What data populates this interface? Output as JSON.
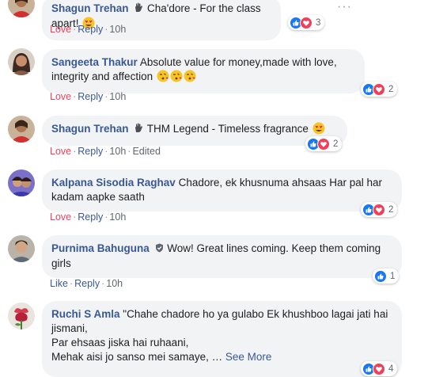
{
  "colors": {
    "link_blue": "#385898",
    "love_red": "#f33e58",
    "bubble_bg": "#f2f3f5",
    "meta_gray": "#606770"
  },
  "comments": [
    {
      "author": "Shagun Trehan",
      "author_badge_icon": "waving-hand-icon",
      "text": "Cha'dore - For the class apart!",
      "emojis": [
        "heart-eyes-emoji-icon"
      ],
      "reaction_label": "Love",
      "reply_label": "Reply",
      "time": "10h",
      "edited": "",
      "reaction_count": "3",
      "reaction_icons": [
        "like-reaction-icon",
        "love-reaction-icon"
      ]
    },
    {
      "author": "Sangeeta Thakur",
      "text": "Absolute value for money,made with love, integrity and affection",
      "emojis": [
        "kissing-heart-emoji-icon",
        "kissing-heart-emoji-icon",
        "kissing-heart-emoji-icon"
      ],
      "reaction_label": "Love",
      "reply_label": "Reply",
      "time": "10h",
      "reaction_count": "2",
      "reaction_icons": [
        "like-reaction-icon",
        "love-reaction-icon"
      ]
    },
    {
      "author": "Shagun Trehan",
      "author_badge_icon": "waving-hand-icon",
      "text": "THM Legend - Timeless fragrance",
      "emojis": [
        "heart-eyes-emoji-icon"
      ],
      "reaction_label": "Love",
      "reply_label": "Reply",
      "time": "10h",
      "edited": "Edited",
      "reaction_count": "2",
      "reaction_icons": [
        "like-reaction-icon",
        "love-reaction-icon"
      ]
    },
    {
      "author": "Kalpana Sisodia Raghav",
      "text": "Chadore, ek khusnuma ahsaas Har pal har kadam aapke saath",
      "reaction_label": "Love",
      "reply_label": "Reply",
      "time": "10h",
      "reaction_count": "2",
      "reaction_icons": [
        "like-reaction-icon",
        "love-reaction-icon"
      ]
    },
    {
      "author": "Purnima Bahuguna",
      "author_badge_icon": "verified-shield-icon",
      "text": "Wow! Great lines coming. Keep them coming girls",
      "reaction_label": "Like",
      "reply_label": "Reply",
      "time": "10h",
      "reaction_count": "1",
      "reaction_icons": [
        "like-reaction-icon"
      ]
    },
    {
      "author": "Ruchi S Amla",
      "text_line1": "\"Chahe chadore ho ya gulabo Ek khushboo lagai jati hai jismani,",
      "text_line2": "Par ehsaas jiska hai ruhaani,",
      "text_line3": "Mehak aisi jo sanso mei samaye, …",
      "see_more": "See More",
      "reaction_count": "4",
      "reaction_icons": [
        "like-reaction-icon",
        "love-reaction-icon"
      ]
    }
  ],
  "more_options_label": "···",
  "separator": "·"
}
